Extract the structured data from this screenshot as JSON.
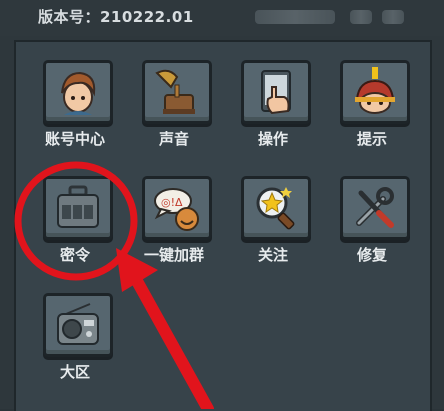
{
  "header": {
    "version_text": "版本号：210222.01"
  },
  "settings_menu": {
    "buttons": [
      {
        "label": "账号中心",
        "icon": "account-avatar-icon"
      },
      {
        "label": "声音",
        "icon": "gramophone-icon"
      },
      {
        "label": "操作",
        "icon": "hand-tap-icon"
      },
      {
        "label": "提示",
        "icon": "tip-helmet-icon"
      },
      {
        "label": "密令",
        "icon": "cipher-lock-icon"
      },
      {
        "label": "一键加群",
        "icon": "speech-bubble-icon"
      },
      {
        "label": "关注",
        "icon": "magnifier-star-icon"
      },
      {
        "label": "修复",
        "icon": "tools-wrench-icon"
      },
      {
        "label": "大区",
        "icon": "radio-icon"
      }
    ]
  },
  "annotation": {
    "color": "#e1141c",
    "highlighted_button": "密令"
  }
}
